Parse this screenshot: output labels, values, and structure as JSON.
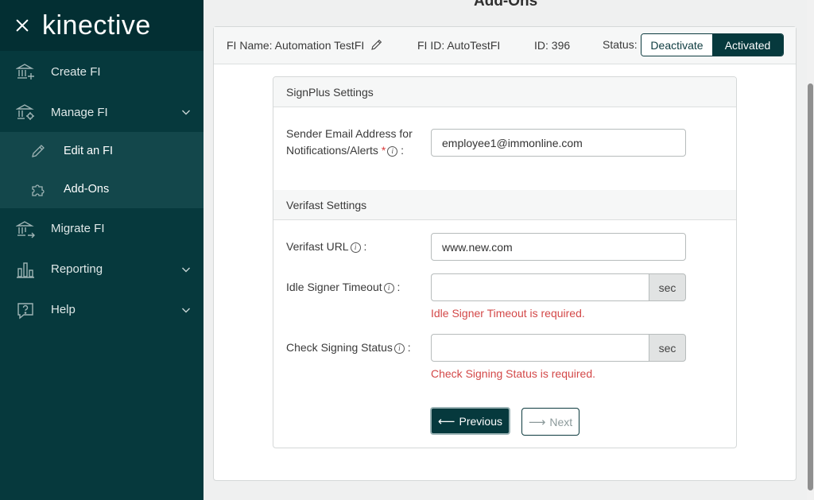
{
  "app": {
    "logo": "kinective"
  },
  "sidebar": {
    "items": [
      {
        "label": "Create FI",
        "icon": "bank-plus-icon"
      },
      {
        "label": "Manage FI",
        "icon": "bank-gear-icon",
        "expanded": true,
        "children": [
          {
            "label": "Edit an FI",
            "icon": "pencil-icon"
          },
          {
            "label": "Add-Ons",
            "icon": "puzzle-icon"
          }
        ]
      },
      {
        "label": "Migrate FI",
        "icon": "bank-arrow-icon"
      },
      {
        "label": "Reporting",
        "icon": "bar-chart-icon"
      },
      {
        "label": "Help",
        "icon": "help-bubble-icon"
      }
    ]
  },
  "main": {
    "title": "Add-Ons",
    "header": {
      "fi_name": "FI Name: Automation TestFI",
      "fi_id": "FI ID: AutoTestFI",
      "id": "ID: 396",
      "status_label": "Status:",
      "deactivate": "Deactivate",
      "activated": "Activated"
    },
    "signplus": {
      "title": "SignPlus Settings",
      "email_label_1": "Sender Email Address for",
      "email_label_2": "Notifications/Alerts",
      "email_value": "employee1@immonline.com"
    },
    "verifast": {
      "title": "Verifast Settings",
      "url_label": "Verifast URL",
      "url_value": "www.new.com",
      "idle_label": "Idle Signer Timeout",
      "idle_unit": "sec",
      "idle_error": "Idle Signer Timeout is required.",
      "check_label": "Check Signing Status",
      "check_unit": "sec",
      "check_error": "Check Signing Status is required."
    },
    "buttons": {
      "previous": "Previous",
      "next": "Next"
    }
  },
  "colors": {
    "sidebar": "#06393d",
    "accent": "#06393d",
    "error": "#d34848"
  }
}
